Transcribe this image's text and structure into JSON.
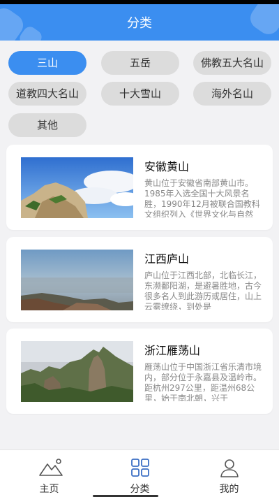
{
  "header": {
    "title": "分类"
  },
  "categories": [
    {
      "label": "三山",
      "active": true
    },
    {
      "label": "五岳",
      "active": false
    },
    {
      "label": "佛教五大名山",
      "active": false
    },
    {
      "label": "道教四大名山",
      "active": false
    },
    {
      "label": "十大雪山",
      "active": false
    },
    {
      "label": "海外名山",
      "active": false
    },
    {
      "label": "其他",
      "active": false
    }
  ],
  "mountains": [
    {
      "name": "安徽黄山",
      "desc": "黄山位于安徽省南部黄山市。1985年入选全国十大风景名胜，1990年12月被联合国教科文组织列入《世界文化与自然"
    },
    {
      "name": "江西庐山",
      "desc": "庐山位于江西北部，北临长江，东濒鄱阳湖，是避暑胜地，古今很多名人到此游历或居住，山上云雾缭绕，到处是"
    },
    {
      "name": "浙江雁荡山",
      "desc": "雁荡山位于中国浙江省乐清市境内，部分位于永嘉县及温岭市。距杭州297公里，距温州68公里，始于南北朝，兴于"
    }
  ],
  "tabs": [
    {
      "label": "主页",
      "icon": "mountain-icon"
    },
    {
      "label": "分类",
      "icon": "grid-icon"
    },
    {
      "label": "我的",
      "icon": "user-icon"
    }
  ],
  "colors": {
    "accent": "#3b8ef0",
    "chip_inactive": "#dcdcdc"
  }
}
